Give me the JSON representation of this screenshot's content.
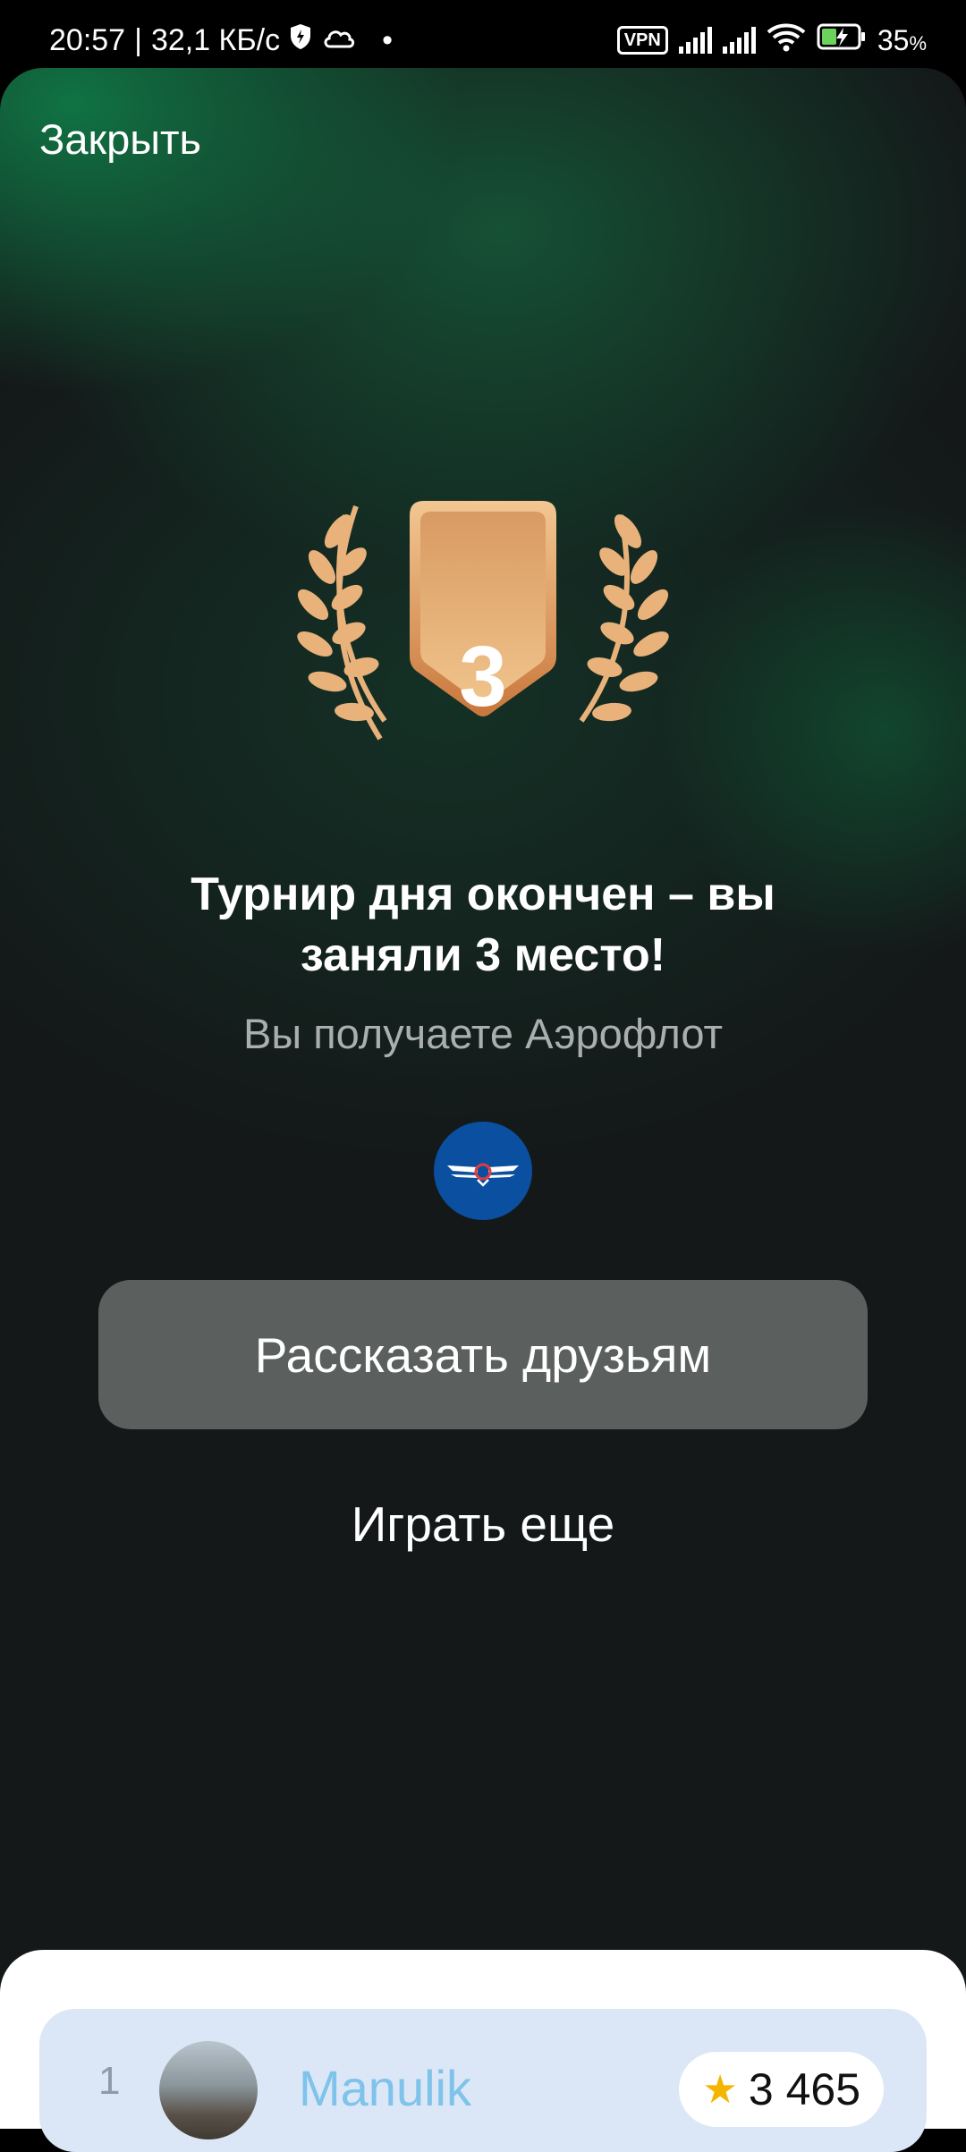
{
  "status_bar": {
    "time": "20:57",
    "separator": "|",
    "speed": "32,1 КБ/с",
    "dot": "•",
    "vpn": "VPN",
    "battery_percent": "35",
    "battery_unit": "%",
    "icons": [
      "shield-bolt-icon",
      "cloud-icon",
      "signal-icon",
      "signal-icon",
      "wifi-icon",
      "battery-charging-icon"
    ]
  },
  "header": {
    "close_label": "Закрыть"
  },
  "result": {
    "place": "3",
    "title_line1": "Турнир дня окончен – вы",
    "title_line2": "заняли 3 место!",
    "subtitle": "Вы получаете Аэрофлот",
    "badge_color": "#e3a66e",
    "laurel_color": "#e8b27a"
  },
  "actions": {
    "share_label": "Рассказать друзьям",
    "play_again_label": "Играть еще"
  },
  "leaderboard": {
    "rows": [
      {
        "rank": "1",
        "name": "Manulik",
        "score": "3 465"
      }
    ]
  }
}
